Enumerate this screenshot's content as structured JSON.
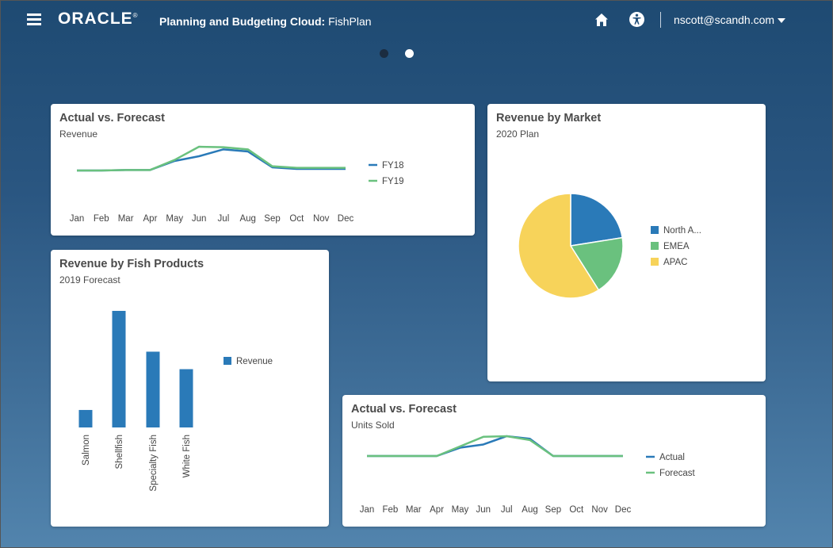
{
  "header": {
    "logo": "ORACLE",
    "title_bold": "Planning and Budgeting Cloud: ",
    "app_name": "FishPlan",
    "user": "nscott@scandh.com"
  },
  "icons": {
    "menu": "hamburger-menu-icon",
    "home": "home-icon",
    "accessibility": "accessibility-icon",
    "dropdown": "caret-down-icon"
  },
  "colors": {
    "series1": "#2a7ab8",
    "series2": "#6ac17e",
    "pie_north": "#2a7ab8",
    "pie_emea": "#6ac17e",
    "pie_apac": "#f7d35a"
  },
  "pager": {
    "count": 2,
    "active": 2
  },
  "cards": {
    "actual_forecast_revenue": {
      "title": "Actual vs. Forecast",
      "subtitle": "Revenue"
    },
    "revenue_market": {
      "title": "Revenue by Market",
      "subtitle": "2020 Plan"
    },
    "fish_products": {
      "title": "Revenue by Fish Products",
      "subtitle": "2019 Forecast"
    },
    "actual_forecast_units": {
      "title": "Actual vs. Forecast",
      "subtitle": "Units Sold"
    }
  },
  "chart_data": [
    {
      "id": "revenue_line",
      "type": "line",
      "title": "Actual vs. Forecast",
      "subtitle": "Revenue",
      "categories": [
        "Jan",
        "Feb",
        "Mar",
        "Apr",
        "May",
        "Jun",
        "Jul",
        "Aug",
        "Sep",
        "Oct",
        "Nov",
        "Dec"
      ],
      "series": [
        {
          "name": "FY18",
          "values": [
            100,
            100,
            101,
            101,
            118,
            127,
            140,
            136,
            106,
            103,
            103,
            103
          ]
        },
        {
          "name": "FY19",
          "values": [
            100,
            100,
            101,
            101,
            120,
            145,
            144,
            140,
            108,
            105,
            105,
            105
          ]
        }
      ],
      "legend": "right"
    },
    {
      "id": "market_pie",
      "type": "pie",
      "title": "Revenue by Market",
      "subtitle": "2020 Plan",
      "labels": [
        "North A...",
        "EMEA",
        "APAC"
      ],
      "values": [
        22.5,
        18.5,
        59
      ],
      "legend": "right"
    },
    {
      "id": "fish_bar",
      "type": "bar",
      "title": "Revenue by Fish Products",
      "subtitle": "2019 Forecast",
      "categories": [
        "Salmon",
        "Shellfish",
        "Specialty Fish",
        "White Fish"
      ],
      "series": [
        {
          "name": "Revenue",
          "values": [
            15,
            100,
            65,
            50
          ]
        }
      ],
      "legend": "right"
    },
    {
      "id": "units_line",
      "type": "line",
      "title": "Actual vs. Forecast",
      "subtitle": "Units Sold",
      "categories": [
        "Jan",
        "Feb",
        "Mar",
        "Apr",
        "May",
        "Jun",
        "Jul",
        "Aug",
        "Sep",
        "Oct",
        "Nov",
        "Dec"
      ],
      "series": [
        {
          "name": "Actual",
          "values": [
            100,
            100,
            100,
            100,
            113,
            118,
            131,
            127,
            100,
            100,
            100,
            100
          ]
        },
        {
          "name": "Forecast",
          "values": [
            100,
            100,
            100,
            100,
            115,
            130,
            131,
            125,
            100,
            100,
            100,
            100
          ]
        }
      ],
      "legend": "right"
    }
  ]
}
